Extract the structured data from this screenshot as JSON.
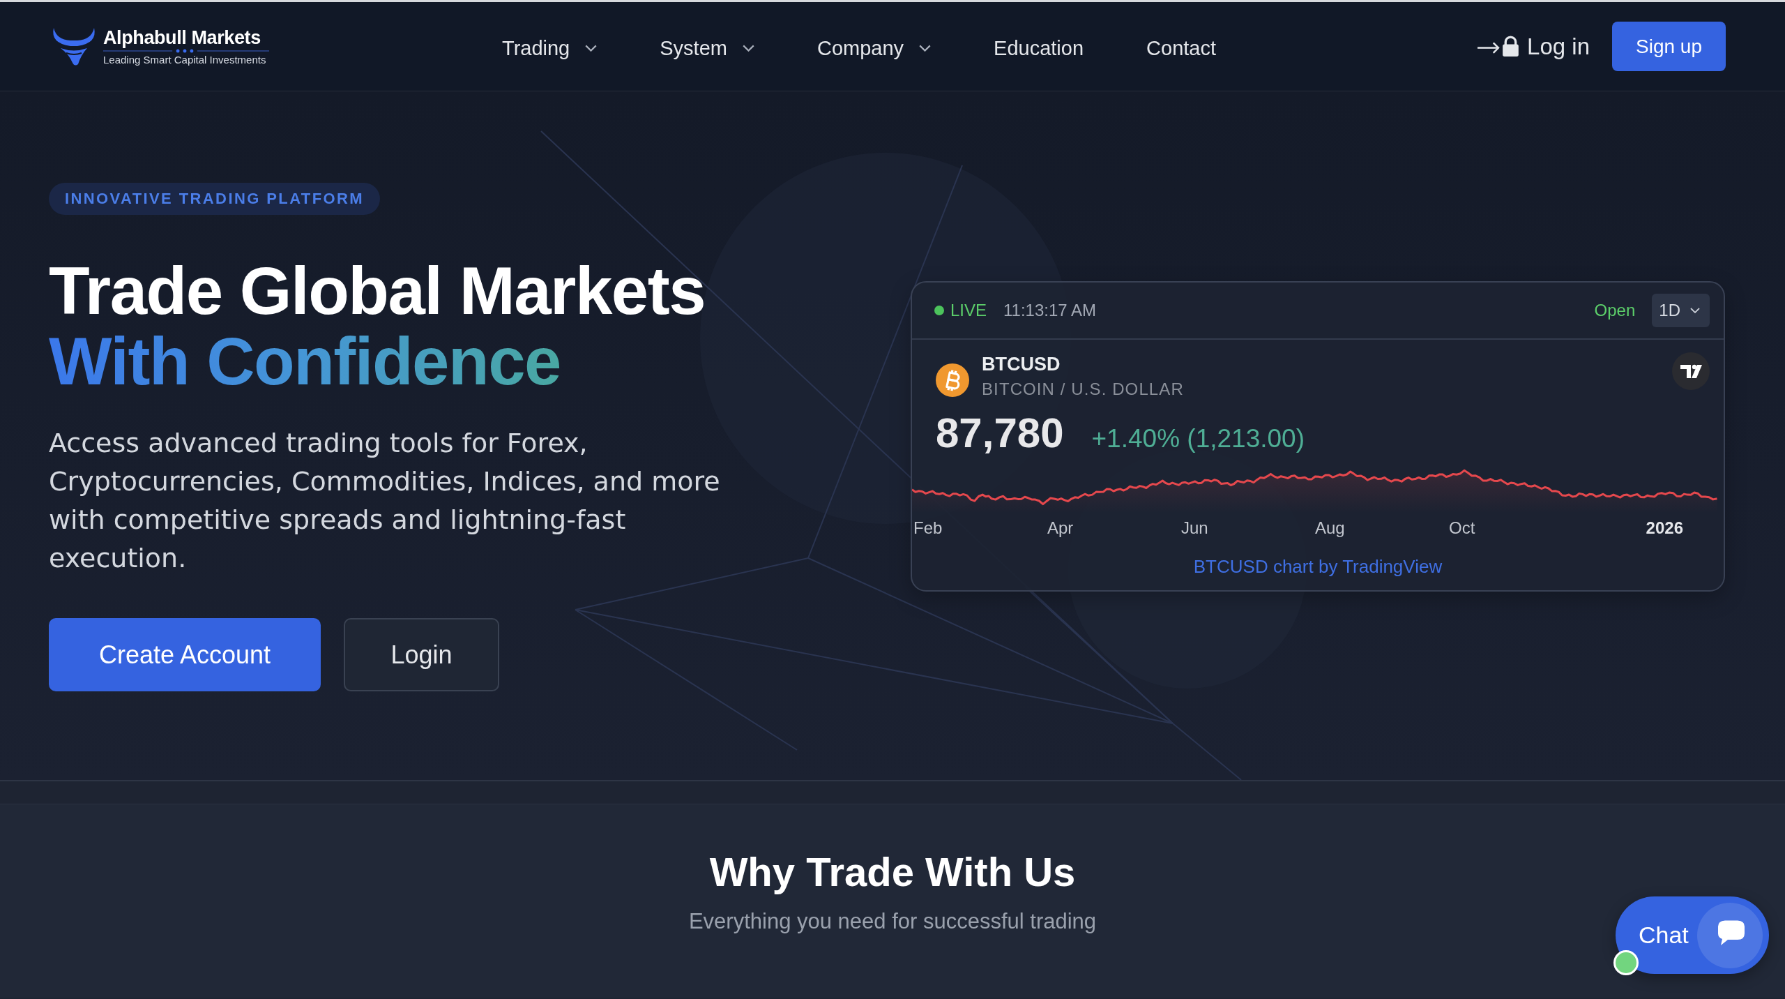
{
  "header": {
    "logo": {
      "name": "Alphabull Markets",
      "tagline": "Leading Smart Capital Investments"
    },
    "nav": [
      {
        "label": "Trading",
        "kind": "dropdown"
      },
      {
        "label": "System",
        "kind": "dropdown"
      },
      {
        "label": "Company",
        "kind": "dropdown"
      },
      {
        "label": "Education",
        "kind": "link"
      },
      {
        "label": "Contact",
        "kind": "link"
      }
    ],
    "login": "Log in",
    "signup": "Sign up"
  },
  "hero": {
    "badge": "INNOVATIVE TRADING PLATFORM",
    "title": "Trade Global Markets",
    "title_highlight": "With Confidence",
    "description": "Access advanced trading tools for Forex, Cryptocurrencies, Commodities, Indices, and more with competitive spreads and lightning-fast execution.",
    "buttons": [
      {
        "label": "Create Account",
        "kind": "primary"
      },
      {
        "label": "Login",
        "kind": "secondary"
      }
    ]
  },
  "ticker_widget": {
    "live": true,
    "status": "LIVE",
    "time": "11:13:17 AM",
    "market": "Open",
    "interval": "1D",
    "symbol": "BTCUSD",
    "description": "BITCOIN / U.S. DOLLAR",
    "price": "87,780",
    "change": "+1.40% (1,213.00)",
    "axis_labels": [
      {
        "label": "Feb",
        "kind": "month"
      },
      {
        "label": "Apr",
        "kind": "month"
      },
      {
        "label": "Jun",
        "kind": "month"
      },
      {
        "label": "Aug",
        "kind": "month"
      },
      {
        "label": "Oct",
        "kind": "month"
      },
      {
        "label": "2026",
        "kind": "year"
      }
    ],
    "attribution": "BTCUSD chart by TradingView"
  },
  "features": {
    "title": "Why Trade With Us",
    "subtitle": "Everything you need for successful trading"
  },
  "chat": {
    "label": "Chat",
    "online": true
  }
}
